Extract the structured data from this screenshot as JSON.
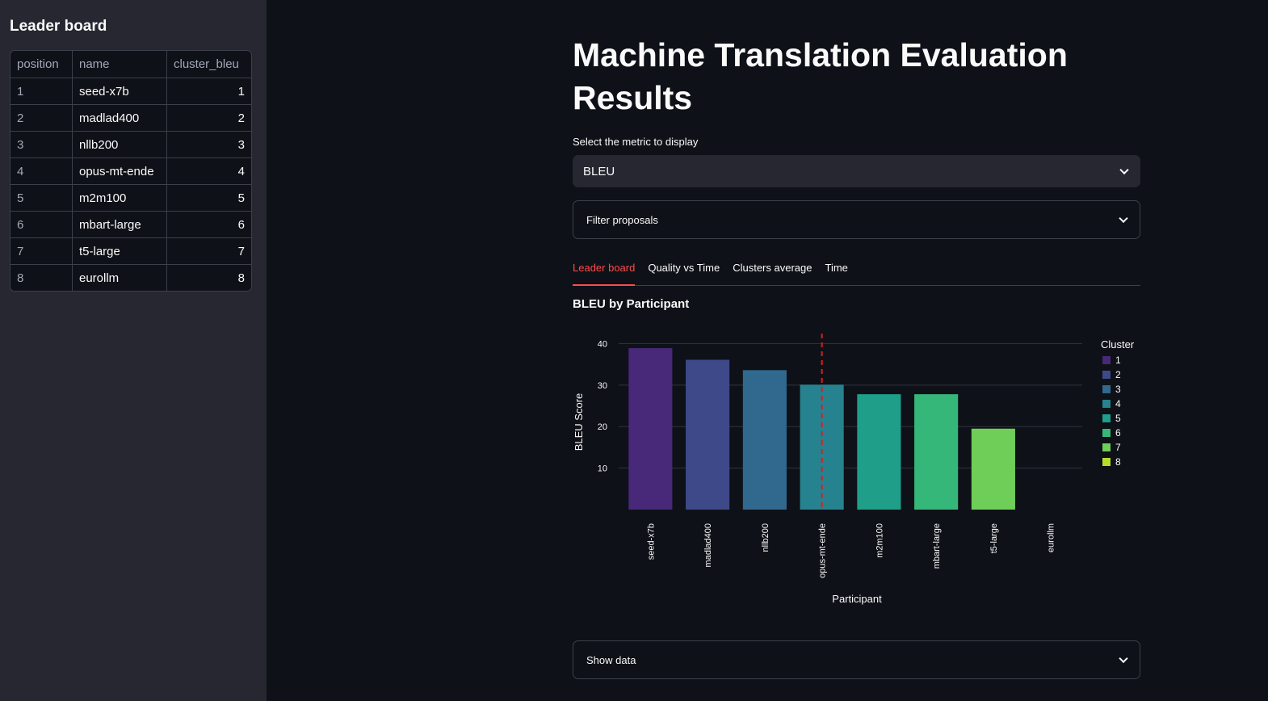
{
  "sidebar": {
    "title": "Leader board",
    "table": {
      "columns": [
        "position",
        "name",
        "cluster_bleu"
      ],
      "rows": [
        [
          "1",
          "seed-x7b",
          "1"
        ],
        [
          "2",
          "madlad400",
          "2"
        ],
        [
          "3",
          "nllb200",
          "3"
        ],
        [
          "4",
          "opus-mt-ende",
          "4"
        ],
        [
          "5",
          "m2m100",
          "5"
        ],
        [
          "6",
          "mbart-large",
          "6"
        ],
        [
          "7",
          "t5-large",
          "7"
        ],
        [
          "8",
          "eurollm",
          "8"
        ]
      ]
    }
  },
  "main": {
    "title": "Machine Translation Evaluation Results",
    "metric_select": {
      "label": "Select the metric to display",
      "value": "BLEU"
    },
    "filter_expander": "Filter proposals",
    "tabs": [
      {
        "label": "Leader board",
        "active": true
      },
      {
        "label": "Quality vs Time",
        "active": false
      },
      {
        "label": "Clusters average",
        "active": false
      },
      {
        "label": "Time",
        "active": false
      }
    ],
    "chart_heading": "BLEU by Participant",
    "show_data_expander": "Show data"
  },
  "colors": {
    "accent": "#ff4b4b",
    "background": "#0e1117",
    "sidebar": "#262730"
  },
  "chart_data": {
    "type": "bar",
    "categories": [
      "seed-x7b",
      "madlad400",
      "nllb200",
      "opus-mt-ende",
      "m2m100",
      "mbart-large",
      "t5-large",
      "eurollm"
    ],
    "values": [
      38.9,
      36.1,
      33.6,
      30.1,
      27.8,
      27.8,
      19.5,
      0
    ],
    "clusters": [
      1,
      2,
      3,
      4,
      5,
      6,
      7,
      8
    ],
    "cluster_colors": [
      "#482878",
      "#3e4989",
      "#31688e",
      "#26828e",
      "#1f9e89",
      "#35b779",
      "#6ece58",
      "#b5de2b"
    ],
    "xlabel": "Participant",
    "ylabel": "BLEU Score",
    "ylim": [
      0,
      43
    ],
    "yticks": [
      10,
      20,
      30,
      40
    ],
    "legend_title": "Cluster",
    "legend_entries": [
      "1",
      "2",
      "3",
      "4",
      "5",
      "6",
      "7",
      "8"
    ],
    "legend_position": "right",
    "threshold_line_after": "opus-mt-ende",
    "grid": true
  }
}
